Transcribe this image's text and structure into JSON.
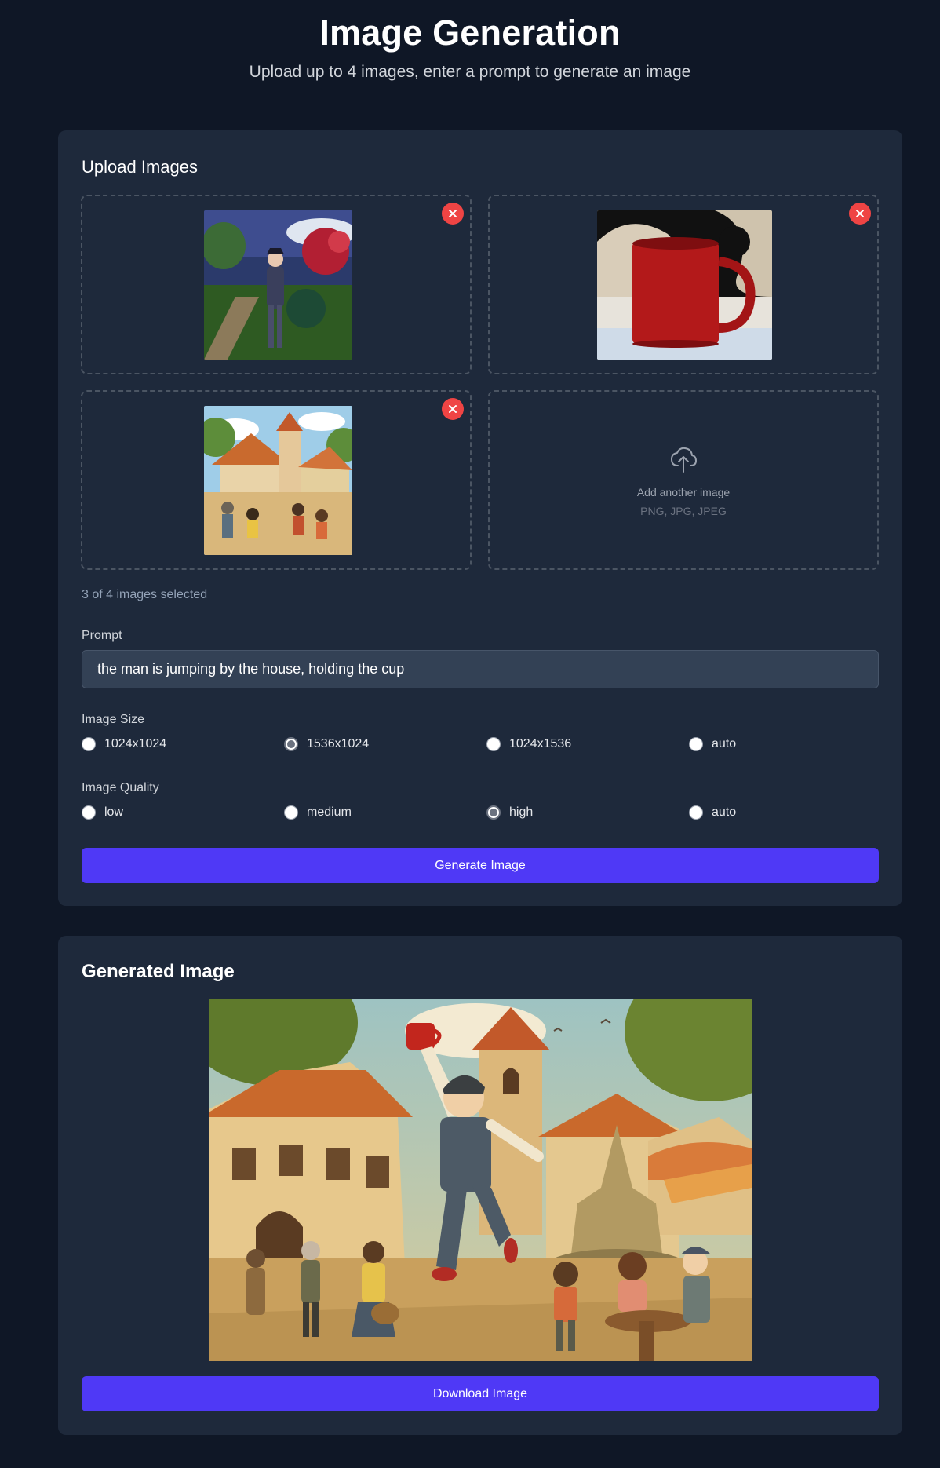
{
  "header": {
    "title": "Image Generation",
    "subtitle": "Upload up to 4 images, enter a prompt to generate an image"
  },
  "upload": {
    "title": "Upload Images",
    "images": [
      {
        "description": "cartoon girl in a garden",
        "remove_icon": "close-icon"
      },
      {
        "description": "red mug on table",
        "remove_icon": "close-icon"
      },
      {
        "description": "cartoon village market scene",
        "remove_icon": "close-icon"
      }
    ],
    "add_slot": {
      "label": "Add another image",
      "formats": "PNG, JPG, JPEG",
      "icon": "cloud-upload-icon"
    },
    "count_text": "3 of 4 images selected"
  },
  "prompt": {
    "label": "Prompt",
    "value": "the man is jumping by the house, holding the cup"
  },
  "image_size": {
    "label": "Image Size",
    "options": [
      "1024x1024",
      "1536x1024",
      "1024x1536",
      "auto"
    ],
    "selected": "1536x1024"
  },
  "image_quality": {
    "label": "Image Quality",
    "options": [
      "low",
      "medium",
      "high",
      "auto"
    ],
    "selected": "high"
  },
  "generate_label": "Generate Image",
  "result": {
    "title": "Generated Image",
    "download_label": "Download Image"
  },
  "colors": {
    "page_bg": "#0f1726",
    "card_bg": "#1e293b",
    "accent": "#4f39f6",
    "danger": "#ef4444"
  }
}
